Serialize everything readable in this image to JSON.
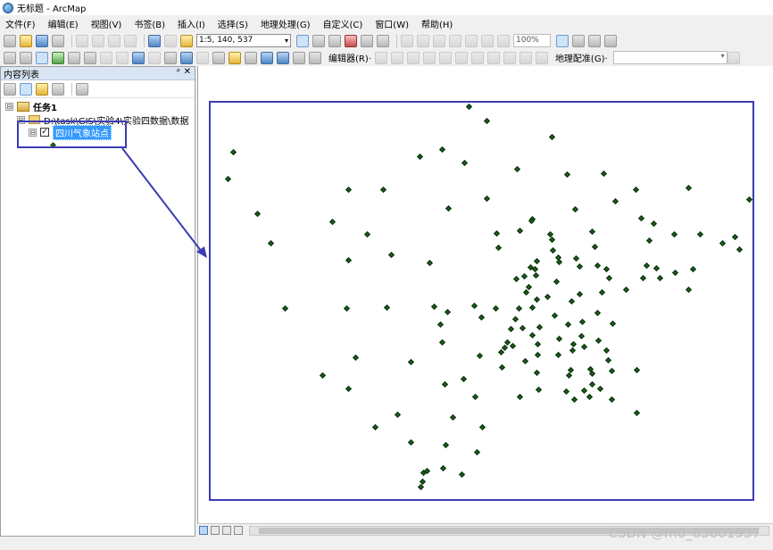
{
  "window": {
    "title": "无标题 - ArcMap"
  },
  "menu": [
    "文件(F)",
    "编辑(E)",
    "视图(V)",
    "书签(B)",
    "插入(I)",
    "选择(S)",
    "地理处理(G)",
    "自定义(C)",
    "窗口(W)",
    "帮助(H)"
  ],
  "toolbar": {
    "scale_value": "1:5, 140, 537",
    "zoom_value": "100%",
    "editor_label": "编辑器(R)·",
    "georef_label": "地理配准(G)·"
  },
  "toc": {
    "title": "内容列表",
    "pin_glyph": "ᵖ",
    "close_glyph": "✕",
    "dataframe": "任务1",
    "folder": "D:\\task\\GIS\\实验4\\实验四数据\\数据",
    "layer": "四川气象站点",
    "layer_checked": true
  },
  "map": {
    "layer": "四川气象站点",
    "point_color": "#1f5a1f",
    "frame_color": "#3c3cb4",
    "station_count": 149
  },
  "watermark": "CSDN @m0_63001937",
  "icons": {
    "app": "arcmap-globe-icon",
    "expander": "⊟",
    "check": "✓",
    "combo": "▾"
  }
}
